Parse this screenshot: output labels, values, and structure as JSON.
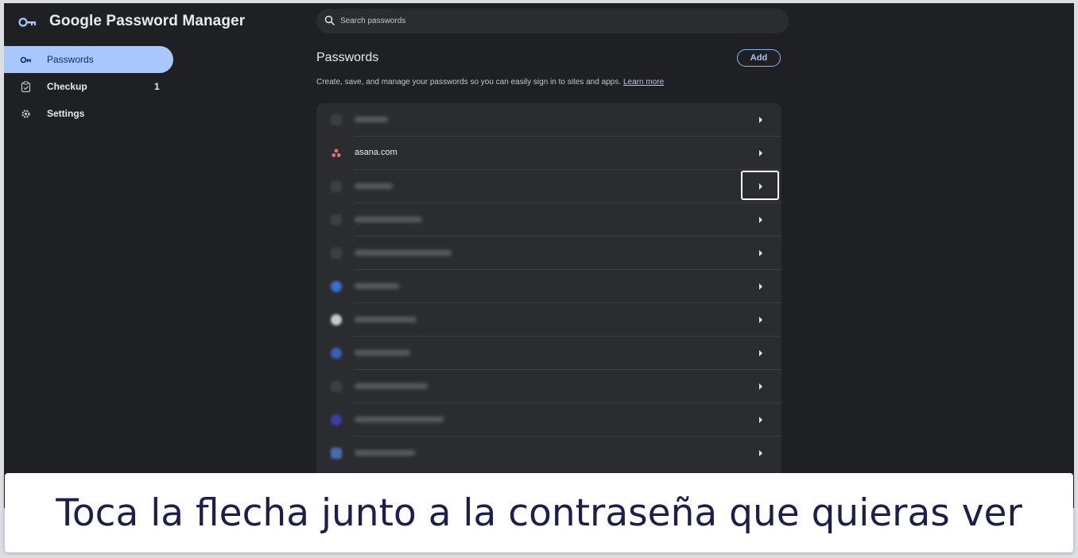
{
  "app": {
    "title": "Google Password Manager",
    "logo_icon": "key-icon"
  },
  "search": {
    "placeholder": "Search passwords",
    "icon": "search-icon"
  },
  "sidebar": {
    "items": [
      {
        "label": "Passwords",
        "icon": "key-icon",
        "active": true,
        "count": ""
      },
      {
        "label": "Checkup",
        "icon": "clipboard-check-icon",
        "active": false,
        "count": "1"
      },
      {
        "label": "Settings",
        "icon": "gear-icon",
        "active": false,
        "count": ""
      }
    ]
  },
  "main": {
    "title": "Passwords",
    "add_label": "Add",
    "description": "Create, save, and manage your passwords so you can easily sign in to sites and apps.",
    "learn_more": "Learn more",
    "rows": [
      {
        "site": "",
        "blurred": true
      },
      {
        "site": "asana.com",
        "blurred": false
      },
      {
        "site": "",
        "blurred": true
      },
      {
        "site": "",
        "blurred": true
      },
      {
        "site": "",
        "blurred": true
      },
      {
        "site": "",
        "blurred": true
      },
      {
        "site": "",
        "blurred": true
      },
      {
        "site": "",
        "blurred": true
      },
      {
        "site": "",
        "blurred": true
      },
      {
        "site": "",
        "blurred": true
      },
      {
        "site": "",
        "blurred": true
      }
    ]
  },
  "colors": {
    "background": "#1f2023",
    "accent": "#a8c7fa",
    "list_bg": "#2b2c30",
    "asana": "#f06a6a"
  },
  "caption": {
    "text": "Toca la flecha junto a la contraseña que quieras ver"
  }
}
